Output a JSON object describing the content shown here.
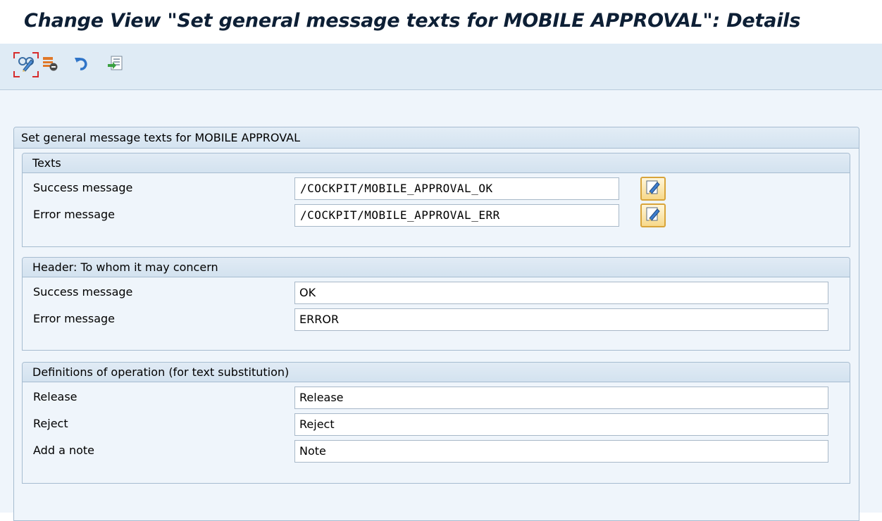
{
  "title": "Change View \"Set general message texts for MOBILE APPROVAL\": Details",
  "toolbar": {
    "buttons": [
      {
        "name": "display-change-icon"
      },
      {
        "name": "delete-entry-icon"
      },
      {
        "name": "undo-icon"
      },
      {
        "name": "transport-icon"
      }
    ]
  },
  "outer_group": {
    "title": "Set general message texts for MOBILE APPROVAL"
  },
  "texts_group": {
    "title": "Texts",
    "rows": [
      {
        "label": "Success message",
        "value": "/COCKPIT/MOBILE_APPROVAL_OK"
      },
      {
        "label": "Error message",
        "value": "/COCKPIT/MOBILE_APPROVAL_ERR"
      }
    ]
  },
  "header_group": {
    "title": "Header: To whom it may concern",
    "rows": [
      {
        "label": "Success message",
        "value": "OK"
      },
      {
        "label": "Error message",
        "value": "ERROR"
      }
    ]
  },
  "operation_group": {
    "title": "Definitions of operation (for text substitution)",
    "rows": [
      {
        "label": "Release",
        "value": "Release"
      },
      {
        "label": "Reject",
        "value": "Reject"
      },
      {
        "label": "Add a note",
        "value": "Note"
      }
    ]
  }
}
